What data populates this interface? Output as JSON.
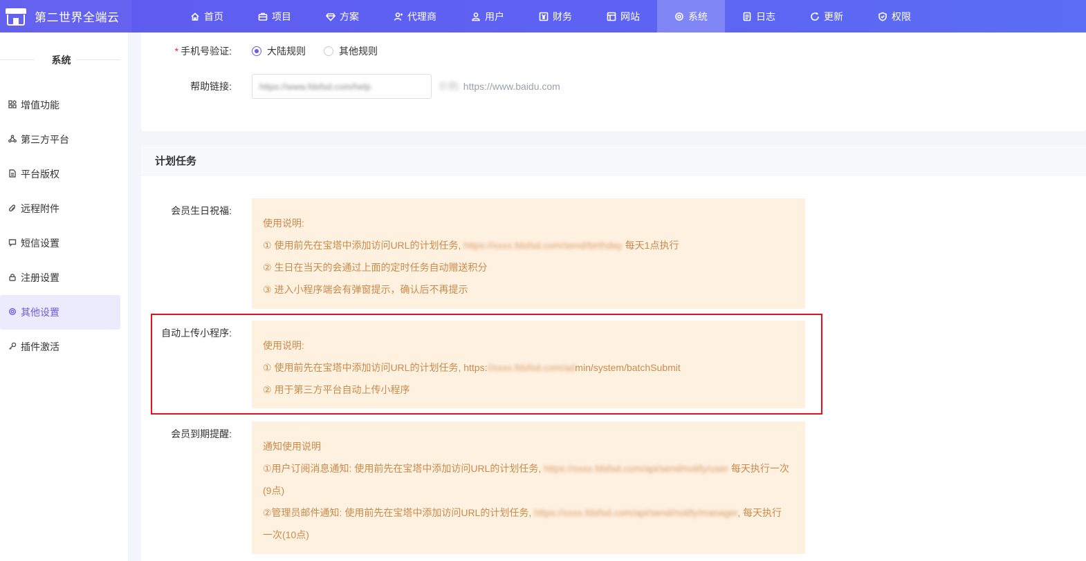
{
  "brand": {
    "name": "第二世界全端云"
  },
  "nav": [
    {
      "label": "首页",
      "icon": "home-icon"
    },
    {
      "label": "项目",
      "icon": "briefcase-icon"
    },
    {
      "label": "方案",
      "icon": "diamond-icon"
    },
    {
      "label": "代理商",
      "icon": "agent-icon"
    },
    {
      "label": "用户",
      "icon": "users-icon"
    },
    {
      "label": "财务",
      "icon": "yen-icon"
    },
    {
      "label": "网站",
      "icon": "layout-icon"
    },
    {
      "label": "系统",
      "icon": "gear-icon",
      "active": true
    },
    {
      "label": "日志",
      "icon": "document-icon"
    },
    {
      "label": "更新",
      "icon": "refresh-icon"
    },
    {
      "label": "权限",
      "icon": "shield-icon"
    }
  ],
  "sidebar": {
    "title": "系统",
    "items": [
      {
        "label": "增值功能",
        "icon": "apps-icon"
      },
      {
        "label": "第三方平台",
        "icon": "share-icon"
      },
      {
        "label": "平台版权",
        "icon": "file-icon"
      },
      {
        "label": "远程附件",
        "icon": "paperclip-icon"
      },
      {
        "label": "短信设置",
        "icon": "message-icon"
      },
      {
        "label": "注册设置",
        "icon": "lock-icon"
      },
      {
        "label": "其他设置",
        "icon": "gear-icon",
        "active": true
      },
      {
        "label": "插件激活",
        "icon": "key-icon"
      }
    ]
  },
  "form": {
    "phone_verify": {
      "label": "手机号验证:",
      "required_mark": "*",
      "options": [
        "大陆规则",
        "其他规则"
      ],
      "selected": "大陆规则"
    },
    "help_link": {
      "label": "帮助链接:",
      "value": "https://www.fdsfsd.com/help",
      "hint_prefix": "示例:",
      "hint_url": "https://www.baidu.com"
    }
  },
  "cron": {
    "section_title": "计划任务",
    "birthday": {
      "label": "会员生日祝福:",
      "title": "使用说明:",
      "line1_prefix": "① 使用前先在宝塔中添加访问URL的计划任务,",
      "line1_url": "https://xxxx.fdsfsd.com/send/birthday",
      "line1_suffix": "每天1点执行",
      "line2": "② 生日在当天的会通过上面的定时任务自动赠送积分",
      "line3": "③ 进入小程序端会有弹窗提示，确认后不再提示"
    },
    "auto_upload": {
      "label": "自动上传小程序:",
      "title": "使用说明:",
      "line1_prefix": "① 使用前先在宝塔中添加访问URL的计划任务, https:",
      "line1_url": "//xxxx.fdsfsd.com/ad",
      "line1_suffix": "min/system/batchSubmit",
      "line2": "② 用于第三方平台自动上传小程序"
    },
    "expire": {
      "label": "会员到期提醒:",
      "title": "通知使用说明",
      "line1_prefix": "①用户订阅消息通知: 使用前先在宝塔中添加访问URL的计划任务,",
      "line1_url": "https://xxxx.fdsfsd.com/api/send/notify/user",
      "line1_suffix": "每天执行一次(9点)",
      "line2_prefix": "②管理员邮件通知: 使用前先在宝塔中添加访问URL的计划任务,",
      "line2_url": "https://xxxx.fdsfsd.com/api/send/notify/manager",
      "line2_suffix": ", 每天执行一次(10点)"
    }
  },
  "colors": {
    "topbar": "#5f5bef",
    "accent": "#6b5ce7",
    "notice_bg": "#fff1e0",
    "notice_text": "#c98a4b",
    "highlight": "#e3101b"
  }
}
